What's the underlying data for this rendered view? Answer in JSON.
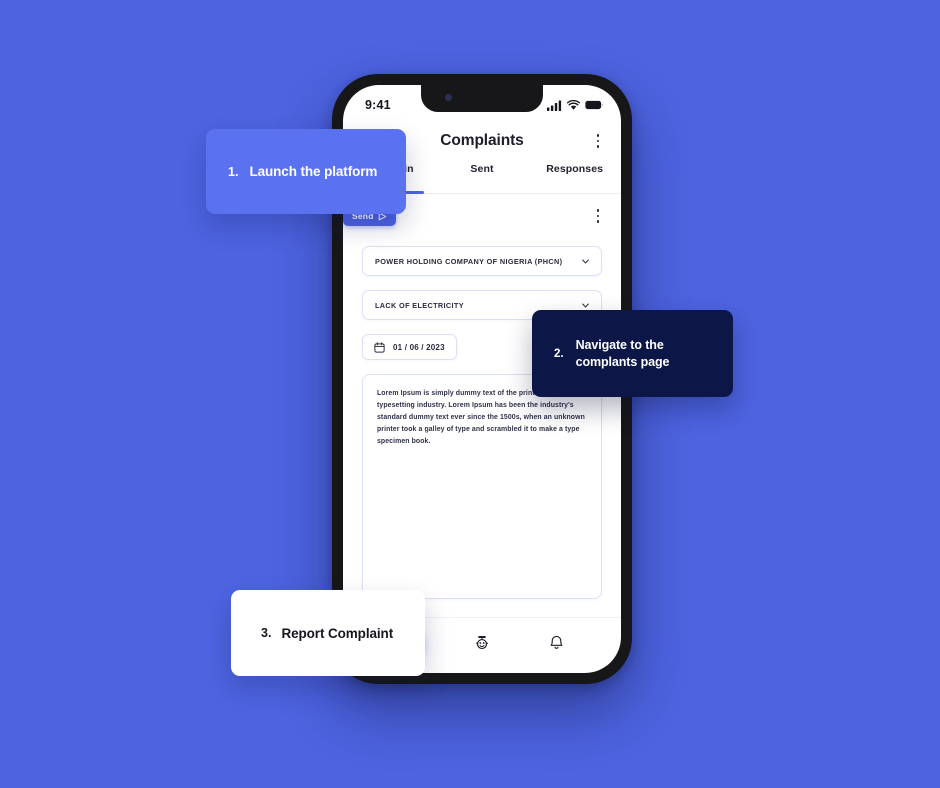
{
  "background_color": "#4d63e0",
  "phone": {
    "status_bar": {
      "time": "9:41",
      "icons": [
        "signal-icon",
        "wifi-icon",
        "battery-icon"
      ]
    },
    "header": {
      "title": "Complaints",
      "avatar": "user-avatar",
      "menu_icon": "kebab-menu-icon"
    },
    "tabs": [
      {
        "label": "Complain",
        "active": true
      },
      {
        "label": "Sent",
        "active": false
      },
      {
        "label": "Responses",
        "active": false
      }
    ],
    "action_row": {
      "send_label": "Send",
      "send_icon": "paper-plane-icon",
      "overflow_icon": "kebab-menu-icon"
    },
    "form": {
      "organization_select": {
        "value": "POWER HOLDING COMPANY OF NIGERIA (PHCN)",
        "chevron": "chevron-down-icon"
      },
      "issue_select": {
        "value": "LACK OF ELECTRICITY",
        "chevron": "chevron-down-icon"
      },
      "date_field": {
        "value": "01 / 06 / 2023",
        "icon": "calendar-icon"
      },
      "description": {
        "value": "Lorem Ipsum is simply dummy text of the printing and typesetting industry. Lorem Ipsum has been the industry's standard dummy text ever since the 1500s, when an unknown printer took a galley of type and scrambled it to make a type specimen book."
      }
    },
    "bottom_nav": [
      {
        "icon": "pen-edit-icon",
        "active": true
      },
      {
        "icon": "robot-chatbot-icon",
        "active": false
      },
      {
        "icon": "bell-notification-icon",
        "active": false
      }
    ]
  },
  "steps": [
    {
      "number": "1.",
      "text": "Launch the platform",
      "color": "#5a72ef",
      "text_color": "#ffffff"
    },
    {
      "number": "2.",
      "text": "Navigate to the complants page",
      "color": "#0c1747",
      "text_color": "#ffffff"
    },
    {
      "number": "3.",
      "text": "Report Complaint",
      "color": "#ffffff",
      "text_color": "#15161f"
    }
  ]
}
